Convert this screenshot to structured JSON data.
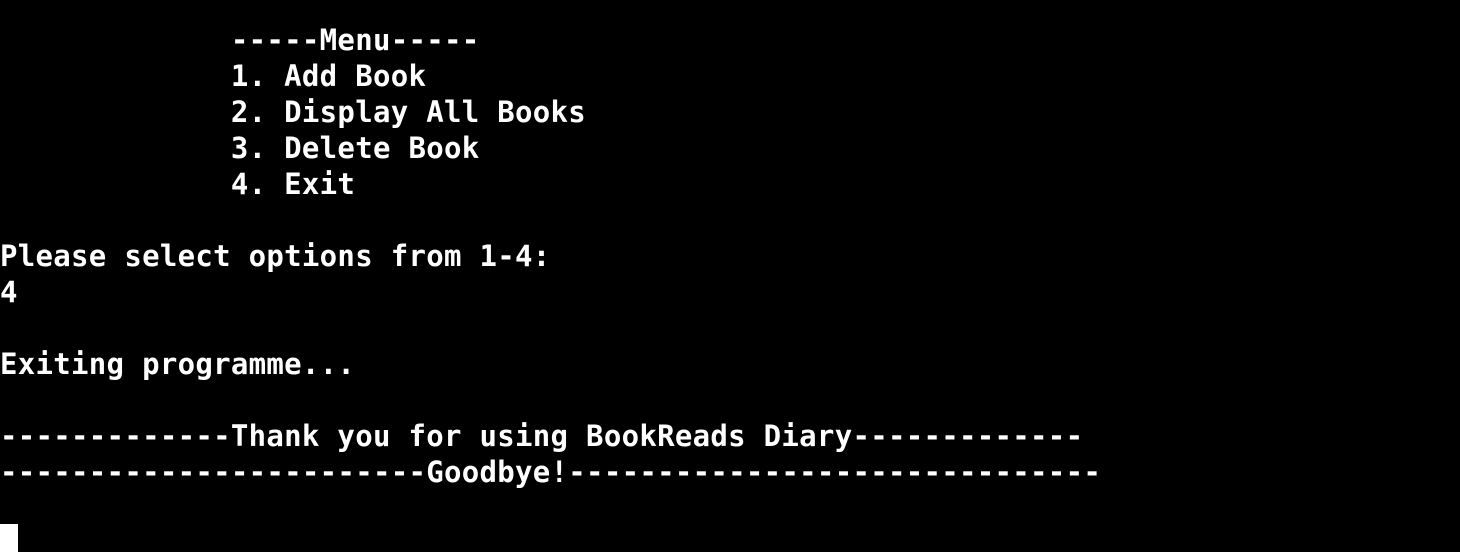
{
  "terminal": {
    "lines": [
      "             -----Menu-----",
      "             1. Add Book",
      "             2. Display All Books",
      "             3. Delete Book",
      "             4. Exit",
      "Please select options from 1-4:",
      "4",
      "Exiting programme...",
      "-------------Thank you for using BookReads Diary-------------",
      "------------------------Goodbye!------------------------------"
    ],
    "cursor": "block"
  },
  "colors": {
    "background": "#000000",
    "text": "#ffffff"
  }
}
